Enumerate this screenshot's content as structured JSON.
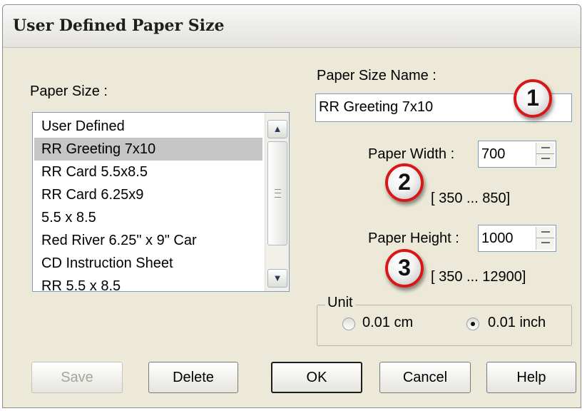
{
  "window": {
    "title": "User Defined Paper Size"
  },
  "paper_size": {
    "label": "Paper Size :",
    "items": [
      "User Defined",
      "RR Greeting 7x10",
      "RR Card 5.5x8.5",
      "RR Card 6.25x9",
      "5.5 x 8.5",
      "Red River 6.25\" x 9\" Car",
      "CD Instruction Sheet",
      "RR 5.5 x 8.5"
    ],
    "selected": "RR Greeting 7x10"
  },
  "paper_size_name": {
    "label": "Paper Size Name :",
    "value": "RR Greeting 7x10"
  },
  "paper_width": {
    "label": "Paper Width  :",
    "value": "700",
    "range": "[  350 ...    850]"
  },
  "paper_height": {
    "label": "Paper Height :",
    "value": "1000",
    "range": "[  350 ... 12900]"
  },
  "unit": {
    "label": "Unit",
    "options": [
      {
        "label": "0.01 cm",
        "checked": false
      },
      {
        "label": "0.01 inch",
        "checked": true
      }
    ]
  },
  "callouts": [
    "1",
    "2",
    "3"
  ],
  "buttons": {
    "save": "Save",
    "delete": "Delete",
    "ok": "OK",
    "cancel": "Cancel",
    "help": "Help"
  },
  "icons": {
    "scroll_up": "scroll-up-arrow-icon",
    "scroll_down": "scroll-down-arrow-icon",
    "accent": "#d81818"
  }
}
